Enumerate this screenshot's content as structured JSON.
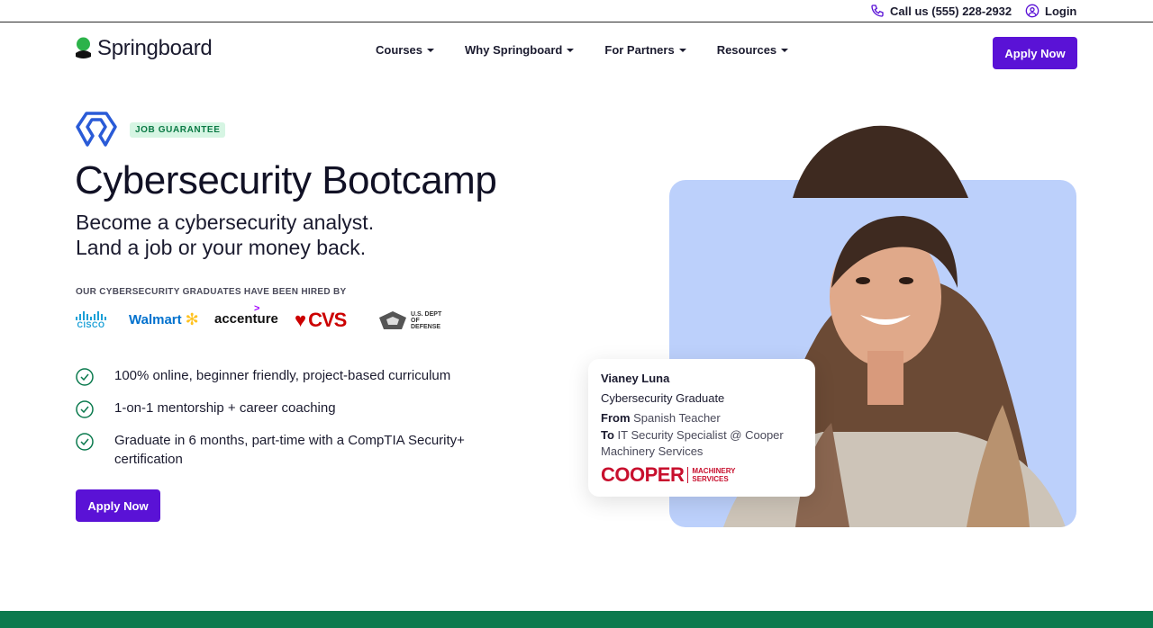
{
  "utility": {
    "call_label": "Call us (555) 228-2932",
    "login_label": "Login"
  },
  "nav": {
    "logo_text": "Springboard",
    "items": [
      {
        "label": "Courses"
      },
      {
        "label": "Why Springboard"
      },
      {
        "label": "For Partners"
      },
      {
        "label": "Resources"
      }
    ],
    "apply_label": "Apply Now"
  },
  "hero": {
    "badge": "JOB GUARANTEE",
    "title": "Cybersecurity Bootcamp",
    "subtitle_line1": "Become a cybersecurity analyst.",
    "subtitle_line2": "Land a job or your money back.",
    "hired_label": "OUR CYBERSECURITY GRADUATES HAVE BEEN HIRED BY",
    "companies": {
      "cisco": "CISCO",
      "walmart": "Walmart",
      "accenture": "accenture",
      "cvs": "CVS",
      "dod": "U.S. DEPT OF DEFENSE"
    },
    "features": [
      "100% online, beginner friendly, project-based curriculum",
      "1-on-1 mentorship + career coaching",
      "Graduate in 6 months, part-time with a CompTIA Security+ certification"
    ],
    "apply_label": "Apply Now"
  },
  "graduate": {
    "name": "Vianey Luna",
    "role": "Cybersecurity Graduate",
    "from_label": "From",
    "from_value": "Spanish Teacher",
    "to_label": "To",
    "to_value": "IT Security Specialist @ Cooper Machinery Services",
    "company_logo_big": "COOPER",
    "company_logo_small_1": "MACHINERY",
    "company_logo_small_2": "SERVICES"
  },
  "colors": {
    "brand_purple": "#5a12d6",
    "brand_green": "#0b7a4e",
    "photo_bg": "#bcd0fb"
  }
}
